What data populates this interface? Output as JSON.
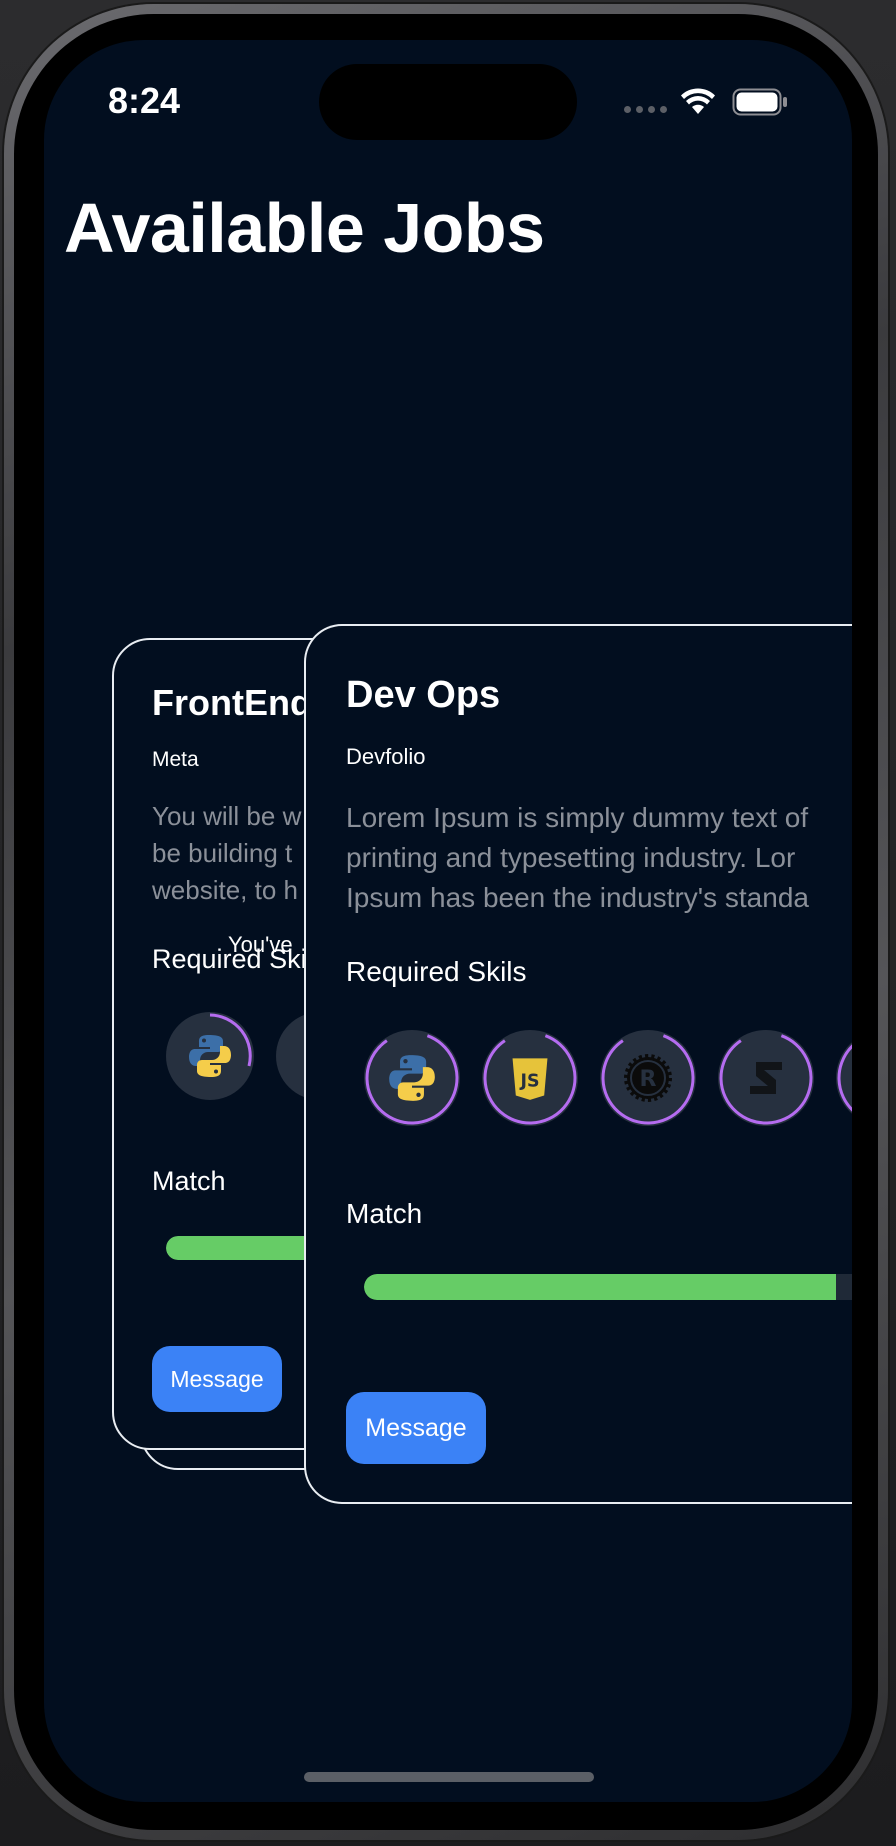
{
  "status_bar": {
    "time": "8:24"
  },
  "page": {
    "title": "Available Jobs"
  },
  "overlap_text": "You've",
  "cards": {
    "back": {
      "title": "FrontEnd",
      "company": "Meta",
      "description": "You will be w\nbe building t\nwebsite, to h",
      "skills_label": "Required Skils",
      "match_label": "Match",
      "match": 0.85,
      "message_label": "Message",
      "skills": [
        "python-icon",
        "javascript-icon"
      ]
    },
    "front": {
      "title": "Dev Ops",
      "company": "Devfolio",
      "description": "Lorem Ipsum is simply dummy text of\nprinting and typesetting industry. Lor\nIpsum has been the industry's standa",
      "skills_label": "Required Skils",
      "match_label": "Match",
      "match": 0.89,
      "message_label": "Message",
      "skills": [
        "python-icon",
        "javascript-icon",
        "rust-icon",
        "swift-icon",
        "skill-icon"
      ]
    }
  },
  "colors": {
    "background": "#020e1f",
    "accent_ring": "#b56cf0",
    "match_fill": "#66cc66",
    "button": "#3b82f6"
  }
}
